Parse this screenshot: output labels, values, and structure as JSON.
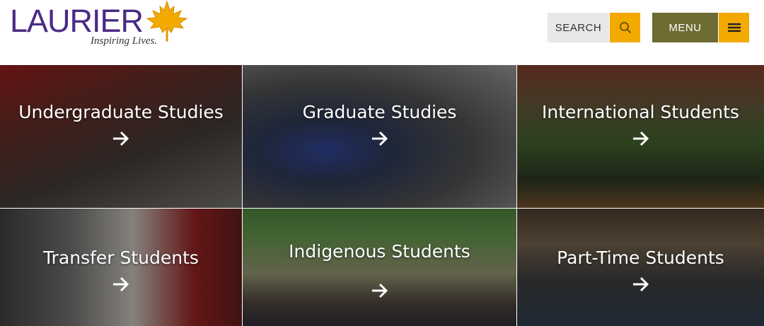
{
  "header": {
    "logo_text": "LAURIER",
    "logo_tagline": "Inspiring Lives.",
    "search_label": "SEARCH",
    "menu_label": "MENU",
    "colors": {
      "purple": "#4b2a85",
      "gold": "#f2a900",
      "olive": "#6e6b33",
      "light_gray": "#e8e8e6"
    },
    "icons": {
      "search": "search-icon",
      "menu": "hamburger-icon",
      "leaf": "maple-leaf-icon"
    }
  },
  "tiles": [
    {
      "label": "Undergraduate Studies",
      "icon": "arrow-right-icon"
    },
    {
      "label": "Graduate Studies",
      "icon": "arrow-right-icon"
    },
    {
      "label": "International Students",
      "icon": "arrow-right-icon"
    },
    {
      "label": "Transfer Students",
      "icon": "arrow-right-icon"
    },
    {
      "label": "Indigenous Students",
      "icon": "arrow-right-icon"
    },
    {
      "label": "Part-Time Students",
      "icon": "arrow-right-icon"
    }
  ]
}
